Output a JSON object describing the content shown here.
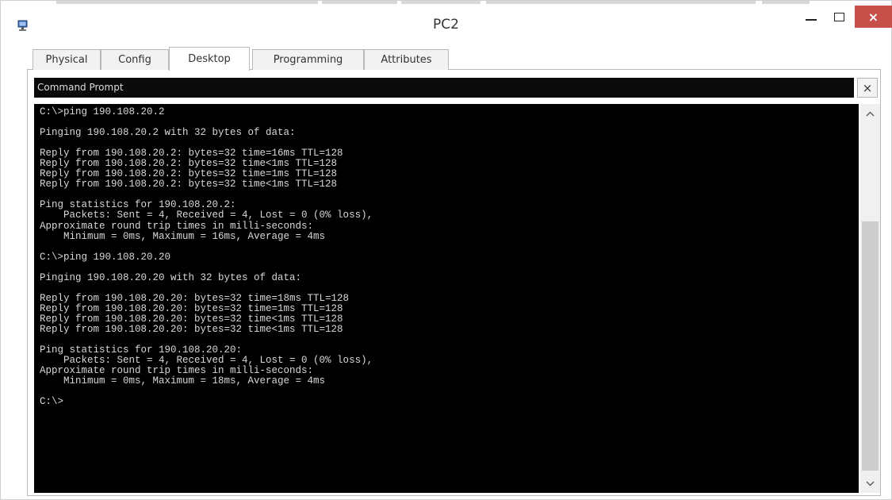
{
  "window": {
    "title": "PC2",
    "close_glyph": "×"
  },
  "tabs": [
    {
      "label": "Physical"
    },
    {
      "label": "Config"
    },
    {
      "label": "Desktop"
    },
    {
      "label": "Programming"
    },
    {
      "label": "Attributes"
    }
  ],
  "active_tab": "Desktop",
  "command_prompt": {
    "title": "Command Prompt",
    "close_glyph": "×",
    "lines": [
      "C:\\>ping 190.108.20.2",
      "",
      "Pinging 190.108.20.2 with 32 bytes of data:",
      "",
      "Reply from 190.108.20.2: bytes=32 time=16ms TTL=128",
      "Reply from 190.108.20.2: bytes=32 time<1ms TTL=128",
      "Reply from 190.108.20.2: bytes=32 time=1ms TTL=128",
      "Reply from 190.108.20.2: bytes=32 time<1ms TTL=128",
      "",
      "Ping statistics for 190.108.20.2:",
      "    Packets: Sent = 4, Received = 4, Lost = 0 (0% loss),",
      "Approximate round trip times in milli-seconds:",
      "    Minimum = 0ms, Maximum = 16ms, Average = 4ms",
      "",
      "C:\\>ping 190.108.20.20",
      "",
      "Pinging 190.108.20.20 with 32 bytes of data:",
      "",
      "Reply from 190.108.20.20: bytes=32 time=18ms TTL=128",
      "Reply from 190.108.20.20: bytes=32 time=1ms TTL=128",
      "Reply from 190.108.20.20: bytes=32 time<1ms TTL=128",
      "Reply from 190.108.20.20: bytes=32 time<1ms TTL=128",
      "",
      "Ping statistics for 190.108.20.20:",
      "    Packets: Sent = 4, Received = 4, Lost = 0 (0% loss),",
      "Approximate round trip times in milli-seconds:",
      "    Minimum = 0ms, Maximum = 18ms, Average = 4ms",
      "",
      "C:\\>"
    ]
  },
  "icons": {
    "app": "packet-tracer-pc-icon",
    "minimize": "minimize-icon",
    "maximize": "maximize-icon",
    "close": "close-icon",
    "scroll_up": "chevron-up-icon",
    "scroll_down": "chevron-down-icon"
  },
  "colors": {
    "close_button": "#c7504a",
    "terminal_background": "#000000",
    "terminal_text": "#d8d8d8"
  }
}
